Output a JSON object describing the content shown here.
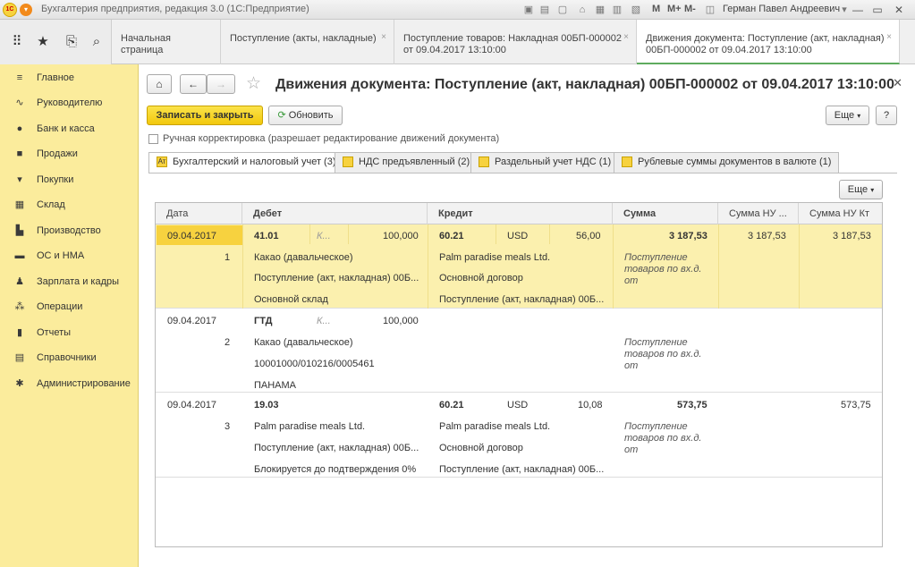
{
  "titlebar": {
    "title": "Бухгалтерия предприятия, редакция 3.0  (1С:Предприятие)",
    "m": "M",
    "mplus": "M+",
    "mminus": "M-",
    "user": "Герман Павел Андреевич"
  },
  "tabs": [
    {
      "label": "Начальная страница"
    },
    {
      "label": "Поступление (акты, накладные)"
    },
    {
      "line1": "Поступление товаров: Накладная 00БП-000002",
      "line2": "от 09.04.2017 13:10:00"
    },
    {
      "line1": "Движения документа: Поступление (акт, накладная)",
      "line2": "00БП-000002 от 09.04.2017 13:10:00"
    }
  ],
  "sidebar": {
    "items": [
      {
        "label": "Главное",
        "icon": "menu-icon"
      },
      {
        "label": "Руководителю",
        "icon": "chart-line-icon"
      },
      {
        "label": "Банк и касса",
        "icon": "coin-icon"
      },
      {
        "label": "Продажи",
        "icon": "bag-icon"
      },
      {
        "label": "Покупки",
        "icon": "cart-icon"
      },
      {
        "label": "Склад",
        "icon": "warehouse-icon"
      },
      {
        "label": "Производство",
        "icon": "factory-icon"
      },
      {
        "label": "ОС и НМА",
        "icon": "truck-icon"
      },
      {
        "label": "Зарплата и кадры",
        "icon": "person-icon"
      },
      {
        "label": "Операции",
        "icon": "operations-icon"
      },
      {
        "label": "Отчеты",
        "icon": "bar-chart-icon"
      },
      {
        "label": "Справочники",
        "icon": "books-icon"
      },
      {
        "label": "Администрирование",
        "icon": "gear-icon"
      }
    ]
  },
  "page": {
    "title": "Движения документа: Поступление (акт, накладная) 00БП-000002 от 09.04.2017 13:10:00",
    "save_close": "Записать и закрыть",
    "refresh": "Обновить",
    "more": "Еще",
    "help": "?",
    "manual_label": "Ручная корректировка (разрешает редактирование движений документа)",
    "subtabs": [
      "Бухгалтерский и налоговый учет (3)",
      "НДС предъявленный (2)",
      "Раздельный учет НДС (1)",
      "Рублевые суммы документов в валюте (1)"
    ],
    "grid_more": "Еще"
  },
  "grid": {
    "headers": [
      "Дата",
      "Дебет",
      "Кредит",
      "Сумма",
      "Сумма НУ ...",
      "Сумма НУ Кт"
    ],
    "rows": [
      {
        "date": "09.04.2017",
        "num": "1",
        "debit_acc": "41.01",
        "debit_k": "К...",
        "debit_qty": "100,000",
        "debit_lines": [
          "Какао (давальческое)",
          "Поступление (акт, накладная) 00Б...",
          "Основной склад"
        ],
        "credit_acc": "60.21",
        "credit_cur": "USD",
        "credit_amt": "56,00",
        "credit_lines": [
          "Palm paradise meals Ltd.",
          "Основной договор",
          "Поступление (акт, накладная) 00Б..."
        ],
        "sum": "3 187,53",
        "sum_desc": [
          "Поступление",
          "товаров по вх.д.",
          "от"
        ],
        "nu_dt": "3 187,53",
        "nu_kt": "3 187,53"
      },
      {
        "date": "09.04.2017",
        "num": "2",
        "debit_acc": "ГТД",
        "debit_k": "К...",
        "debit_qty": "100,000",
        "debit_lines": [
          "Какао (давальческое)",
          "10001000/010216/0005461",
          "ПАНАМА"
        ],
        "sum_desc": [
          "Поступление",
          "товаров по вх.д.",
          "от"
        ]
      },
      {
        "date": "09.04.2017",
        "num": "3",
        "debit_acc": "19.03",
        "debit_lines": [
          "Palm paradise meals Ltd.",
          "Поступление (акт, накладная) 00Б...",
          "Блокируется до подтверждения 0%"
        ],
        "credit_acc": "60.21",
        "credit_cur": "USD",
        "credit_amt": "10,08",
        "credit_lines": [
          "Palm paradise meals Ltd.",
          "Основной договор",
          "Поступление (акт, накладная) 00Б..."
        ],
        "sum": "573,75",
        "sum_desc": [
          "Поступление",
          "товаров по вх.д.",
          "от"
        ],
        "nu_kt": "573,75"
      }
    ]
  },
  "colors": {
    "accent": "#f7d23f",
    "sidebar": "#fbec9c",
    "selected_row": "#fbf0ae",
    "active_tab_line": "#5eab5e"
  }
}
